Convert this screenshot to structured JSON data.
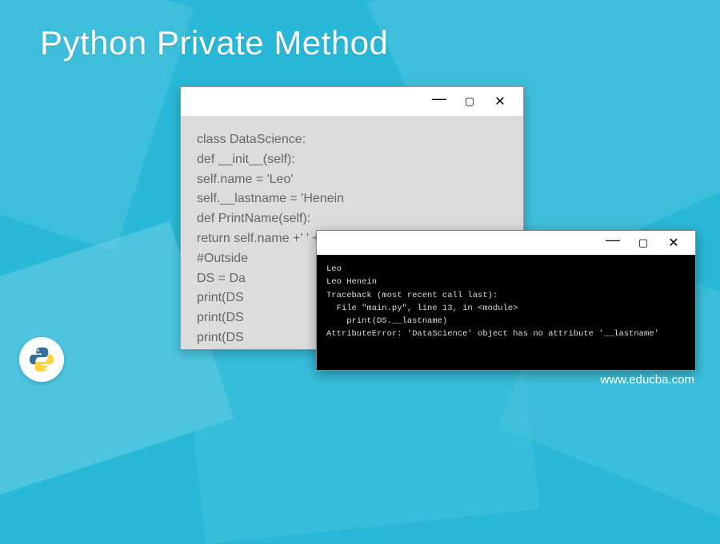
{
  "title": "Python Private Method",
  "editor": {
    "code": [
      "class DataScience:",
      "def __init__(self):",
      "self.name = 'Leo'",
      "self.__lastname = 'Henein",
      "def PrintName(self):",
      "return self.name +' ' + self.__lastname",
      "#Outside",
      "DS = Da",
      "print(DS",
      "print(DS",
      "print(DS"
    ]
  },
  "console": {
    "output": [
      "Leo",
      "Leo Henein",
      "Traceback (most recent call last):",
      "  File \"main.py\", line 13, in <module>",
      "    print(DS.__lastname)",
      "AttributeError: 'DataScience' object has no attribute '__lastname'"
    ]
  },
  "footer": {
    "url": "www.educba.com"
  },
  "window_controls": {
    "minimize": "—",
    "maximize": "▢",
    "close": "✕"
  }
}
